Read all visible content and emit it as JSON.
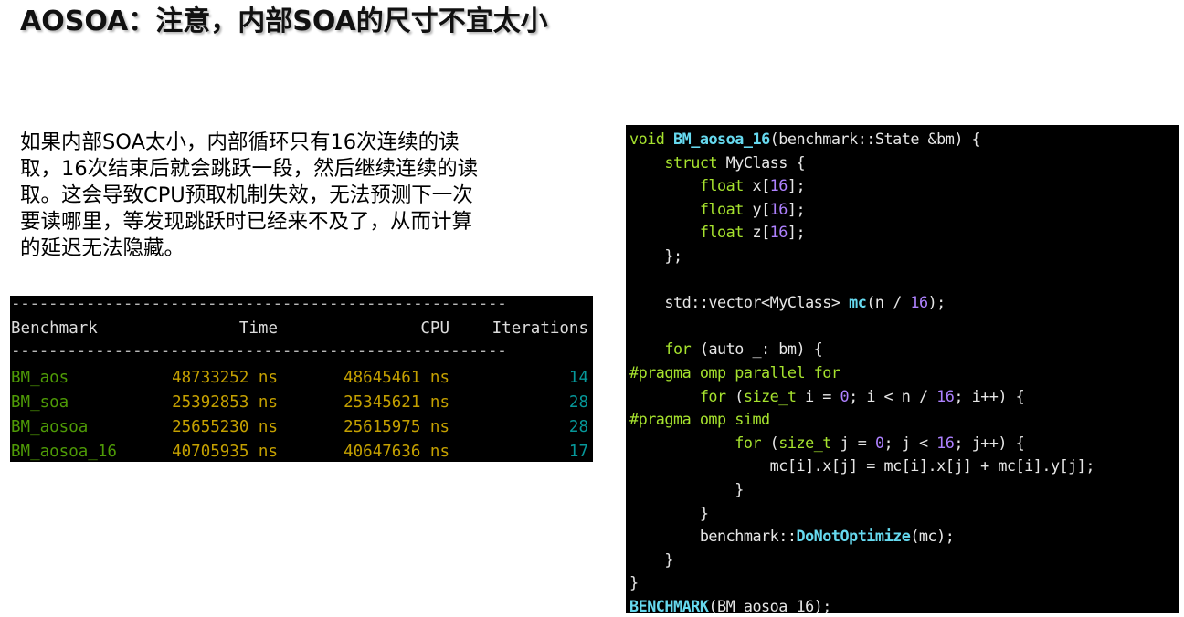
{
  "slide": {
    "title": "AOSOA：注意，内部SOA的尺寸不宜太小",
    "paragraph_lines": [
      "如果内部SOA太小，内部循环只有16次连续的读",
      "取，16次结束后就会跳跃一段，然后继续连续的读",
      "取。这会导致CPU预取机制失效，无法预测下一次",
      "要读哪里，等发现跳跃时已经来不及了，从而计算",
      "的延迟无法隐藏。"
    ]
  },
  "benchmark": {
    "rule": "-----------------------------------------------------",
    "headers": {
      "benchmark": "Benchmark",
      "time": "Time",
      "cpu": "CPU",
      "iterations": "Iterations"
    },
    "rows": [
      {
        "name": "BM_aos",
        "time": "48733252 ns",
        "cpu": "48645461 ns",
        "iterations": "14"
      },
      {
        "name": "BM_soa",
        "time": "25392853 ns",
        "cpu": "25345621 ns",
        "iterations": "28"
      },
      {
        "name": "BM_aosoa",
        "time": "25655230 ns",
        "cpu": "25615975 ns",
        "iterations": "28"
      },
      {
        "name": "BM_aosoa_16",
        "time": "40705935 ns",
        "cpu": "40647636 ns",
        "iterations": "17"
      }
    ],
    "colors": {
      "name": "#4e9a06",
      "number": "#c4a000",
      "iterations": "#06989a"
    }
  },
  "code": {
    "lines": [
      [
        [
          "kw",
          "void "
        ],
        [
          "fnb",
          "BM_aosoa_16"
        ],
        [
          "plain",
          "(benchmark::State &bm) {"
        ]
      ],
      [
        [
          "plain",
          "    "
        ],
        [
          "kw",
          "struct"
        ],
        [
          "plain",
          " MyClass {"
        ]
      ],
      [
        [
          "plain",
          "        "
        ],
        [
          "ty",
          "float"
        ],
        [
          "plain",
          " x["
        ],
        [
          "num-c",
          "16"
        ],
        [
          "plain",
          "];"
        ]
      ],
      [
        [
          "plain",
          "        "
        ],
        [
          "ty",
          "float"
        ],
        [
          "plain",
          " y["
        ],
        [
          "num-c",
          "16"
        ],
        [
          "plain",
          "];"
        ]
      ],
      [
        [
          "plain",
          "        "
        ],
        [
          "ty",
          "float"
        ],
        [
          "plain",
          " z["
        ],
        [
          "num-c",
          "16"
        ],
        [
          "plain",
          "];"
        ]
      ],
      [
        [
          "plain",
          "    };"
        ]
      ],
      [
        [
          "plain",
          ""
        ]
      ],
      [
        [
          "plain",
          "    std::vector<MyClass> "
        ],
        [
          "fnb",
          "mc"
        ],
        [
          "plain",
          "(n / "
        ],
        [
          "num-c",
          "16"
        ],
        [
          "plain",
          ");"
        ]
      ],
      [
        [
          "plain",
          ""
        ]
      ],
      [
        [
          "plain",
          "    "
        ],
        [
          "kw",
          "for"
        ],
        [
          "plain",
          " (auto _: bm) {"
        ]
      ],
      [
        [
          "prag",
          "#pragma omp parallel for"
        ]
      ],
      [
        [
          "plain",
          "        "
        ],
        [
          "kw",
          "for"
        ],
        [
          "plain",
          " ("
        ],
        [
          "ty",
          "size_t"
        ],
        [
          "plain",
          " i = "
        ],
        [
          "num-c",
          "0"
        ],
        [
          "plain",
          "; i < n / "
        ],
        [
          "num-c",
          "16"
        ],
        [
          "plain",
          "; i++) {"
        ]
      ],
      [
        [
          "prag",
          "#pragma omp simd"
        ]
      ],
      [
        [
          "plain",
          "            "
        ],
        [
          "kw",
          "for"
        ],
        [
          "plain",
          " ("
        ],
        [
          "ty",
          "size_t"
        ],
        [
          "plain",
          " j = "
        ],
        [
          "num-c",
          "0"
        ],
        [
          "plain",
          "; j < "
        ],
        [
          "num-c",
          "16"
        ],
        [
          "plain",
          "; j++) {"
        ]
      ],
      [
        [
          "plain",
          "                mc[i].x[j] = mc[i].x[j] + mc[i].y[j];"
        ]
      ],
      [
        [
          "plain",
          "            }"
        ]
      ],
      [
        [
          "plain",
          "        }"
        ]
      ],
      [
        [
          "plain",
          "        benchmark::"
        ],
        [
          "fnb",
          "DoNotOptimize"
        ],
        [
          "plain",
          "(mc);"
        ]
      ],
      [
        [
          "plain",
          "    }"
        ]
      ],
      [
        [
          "plain",
          "}"
        ]
      ],
      [
        [
          "macro",
          "BENCHMARK"
        ],
        [
          "plain",
          "(BM_aosoa_16);"
        ]
      ]
    ]
  }
}
